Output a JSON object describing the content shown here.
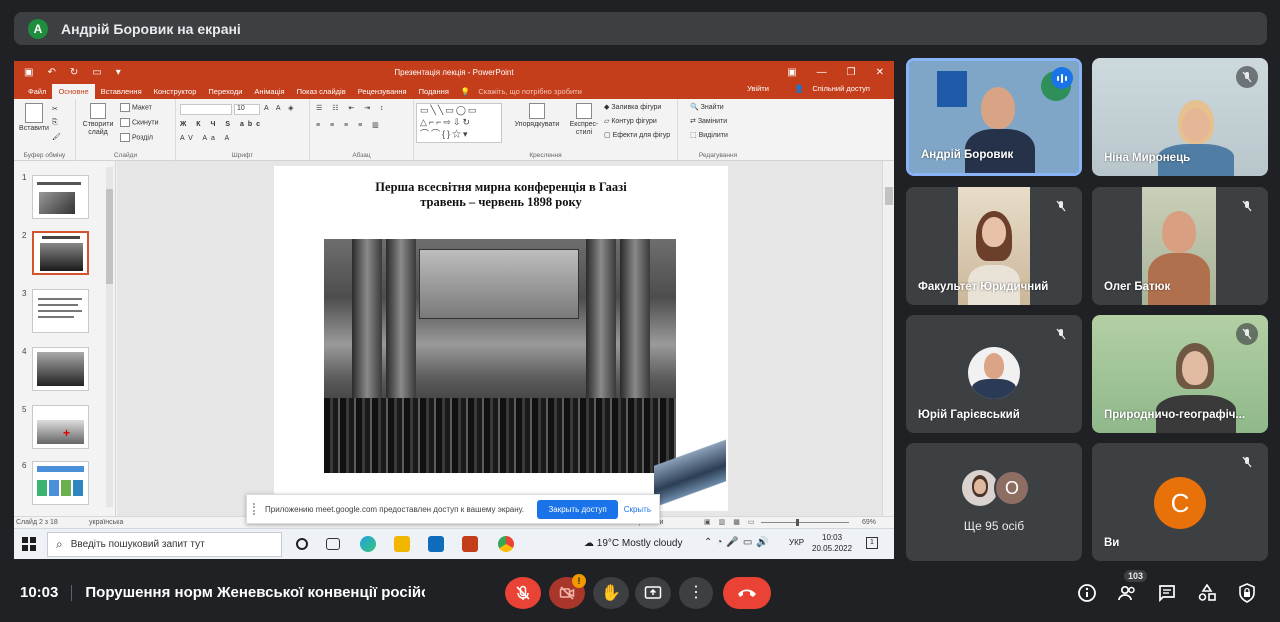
{
  "presenter_banner": {
    "avatar_letter": "A",
    "text": "Андрій Боровик на екрані"
  },
  "powerpoint": {
    "title": "Презентація лекція - PowerPoint",
    "menu": [
      "Файл",
      "Основне",
      "Вставлення",
      "Конструктор",
      "Переходи",
      "Анімація",
      "Показ слайдів",
      "Рецензування",
      "Подання"
    ],
    "active_tab": "Основне",
    "tell_me": "Скажіть, що потрібно зробити",
    "sign_in": "Увійти",
    "share": "Спільний доступ",
    "ribbon": {
      "paste": "Вставити",
      "new_slide": "Створити слайд",
      "layout": "Макет",
      "reset": "Скинути",
      "section": "Розділ",
      "font_size": "10",
      "arrange": "Упорядкувати",
      "quick_styles": "Експрес-стилі",
      "shape_fill": "Заливка фігури",
      "shape_outline": "Контур фігури",
      "shape_effects": "Ефекти для фігур",
      "find": "Знайти",
      "replace": "Замінити",
      "select": "Виділити",
      "groups": [
        "Буфер обміну",
        "Слайди",
        "Шрифт",
        "Абзац",
        "Креслення",
        "Редагування"
      ]
    },
    "slide_numbers": [
      "1",
      "2",
      "3",
      "4",
      "5",
      "6"
    ],
    "selected_slide": 2,
    "slide_title_line1": "Перша всесвітня мирна конференція в Гаазі",
    "slide_title_line2": "травень – червень 1898 року",
    "status_slide": "Слайд 2 з 18",
    "status_lang": "українська",
    "status_notes": "Примітки",
    "zoom": "69%"
  },
  "share_notice": {
    "message": "Приложению meet.google.com предоставлен доступ к вашему экрану.",
    "stop_button": "Закрыть доступ",
    "hide_link": "Скрыть"
  },
  "taskbar": {
    "search_placeholder": "Введіть пошуковий запит тут",
    "weather": "19°C  Mostly cloudy",
    "language": "УКР",
    "time": "10:03",
    "date": "20.05.2022",
    "notifications": "1"
  },
  "participants": [
    {
      "name": "Андрій Боровик",
      "muted": false,
      "speaking": true
    },
    {
      "name": "Ніна Миронець",
      "muted": true
    },
    {
      "name": "Факультет Юридичний",
      "muted": true
    },
    {
      "name": "Олег Батюк",
      "muted": true
    },
    {
      "name": "Юрій Гарієвський",
      "muted": true
    },
    {
      "name": "Природничо-географіч...",
      "muted": true
    },
    {
      "name": "Ще 95 осіб",
      "avatar_letter": "О"
    },
    {
      "name": "Ви",
      "avatar_letter": "C",
      "muted": true
    }
  ],
  "bottom_bar": {
    "clock": "10:03",
    "meeting_title": "Порушення норм Женевської конвенції російсько...",
    "alert_badge": "!",
    "participants_count": "103"
  },
  "colors": {
    "meet_bg": "#202124",
    "tile_bg": "#3c4043",
    "ppt_red": "#c43e1c",
    "end_call": "#ea4335",
    "mic_off": "#ea4335",
    "you_avatar": "#e8710a",
    "accent_blue": "#1a73e8"
  }
}
